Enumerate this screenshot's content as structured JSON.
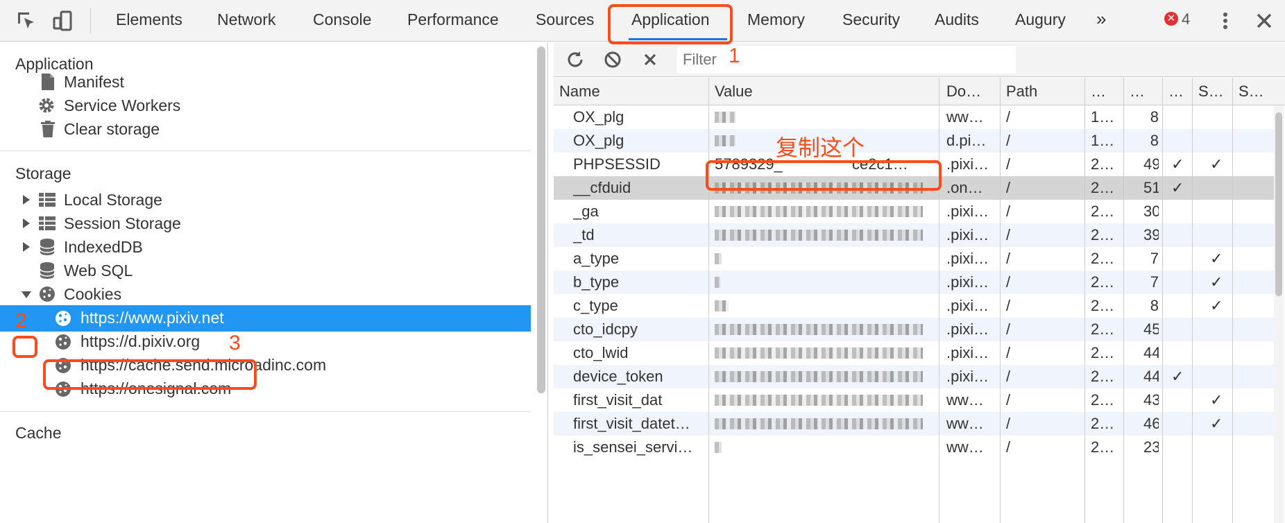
{
  "tabs": [
    "Elements",
    "Network",
    "Console",
    "Performance",
    "Sources",
    "Application",
    "Memory",
    "Security",
    "Audits",
    "Augury"
  ],
  "more_tabs": "»",
  "error_count": "4",
  "error_glyph": "✕",
  "sidebar": {
    "application_title": "Application",
    "application_items": [
      "Manifest",
      "Service Workers",
      "Clear storage"
    ],
    "storage_title": "Storage",
    "storage_items": [
      "Local Storage",
      "Session Storage",
      "IndexedDB",
      "Web SQL",
      "Cookies"
    ],
    "cookie_sites": [
      "https://www.pixiv.net",
      "https://d.pixiv.org",
      "https://cache.send.microadinc.com",
      "https://onesignal.com"
    ],
    "cache_title": "Cache"
  },
  "toolbar": {
    "filter_placeholder": "Filter"
  },
  "annotations": {
    "n1": "1",
    "n2": "2",
    "n3": "3",
    "copy_note": "复制这个"
  },
  "table": {
    "headers": [
      "Name",
      "Value",
      "Do…",
      "Path",
      "…",
      "…",
      "…",
      "S…",
      "S…"
    ],
    "rows": [
      {
        "name": "OX_plg",
        "value": "",
        "domain": "ww…",
        "path": "/",
        "exp": "1…",
        "size": "8",
        "http": "",
        "secure": ""
      },
      {
        "name": "OX_plg",
        "value": "",
        "domain": "d.pi…",
        "path": "/",
        "exp": "1…",
        "size": "8",
        "http": "",
        "secure": ""
      },
      {
        "name": "PHPSESSID",
        "value": "5789329_",
        "value_tail": "ce2c1…",
        "domain": ".pixi…",
        "path": "/",
        "exp": "2…",
        "size": "49",
        "http": "✓",
        "secure": "✓"
      },
      {
        "name": "__cfduid",
        "value": "",
        "domain": ".on…",
        "path": "/",
        "exp": "2…",
        "size": "51",
        "http": "✓",
        "secure": ""
      },
      {
        "name": "_ga",
        "value": "",
        "domain": ".pixi…",
        "path": "/",
        "exp": "2…",
        "size": "30",
        "http": "",
        "secure": ""
      },
      {
        "name": "_td",
        "value": "",
        "domain": ".pixi…",
        "path": "/",
        "exp": "2…",
        "size": "39",
        "http": "",
        "secure": ""
      },
      {
        "name": "a_type",
        "value": "",
        "domain": ".pixi…",
        "path": "/",
        "exp": "2…",
        "size": "7",
        "http": "",
        "secure": "✓"
      },
      {
        "name": "b_type",
        "value": "",
        "domain": ".pixi…",
        "path": "/",
        "exp": "2…",
        "size": "7",
        "http": "",
        "secure": "✓"
      },
      {
        "name": "c_type",
        "value": "",
        "domain": ".pixi…",
        "path": "/",
        "exp": "2…",
        "size": "8",
        "http": "",
        "secure": "✓"
      },
      {
        "name": "cto_idcpy",
        "value": "",
        "domain": ".pixi…",
        "path": "/",
        "exp": "2…",
        "size": "45",
        "http": "",
        "secure": ""
      },
      {
        "name": "cto_lwid",
        "value": "",
        "domain": ".pixi…",
        "path": "/",
        "exp": "2…",
        "size": "44",
        "http": "",
        "secure": ""
      },
      {
        "name": "device_token",
        "value": "",
        "domain": ".pixi…",
        "path": "/",
        "exp": "2…",
        "size": "44",
        "http": "✓",
        "secure": ""
      },
      {
        "name": "first_visit_dat",
        "value": "",
        "domain": "ww…",
        "path": "/",
        "exp": "2…",
        "size": "43",
        "http": "",
        "secure": "✓"
      },
      {
        "name": "first_visit_datet…",
        "value": "",
        "domain": "ww…",
        "path": "/",
        "exp": "2…",
        "size": "46",
        "http": "",
        "secure": "✓"
      },
      {
        "name": "is_sensei_servi…",
        "value": "",
        "domain": "ww…",
        "path": "/",
        "exp": "2…",
        "size": "23",
        "http": "",
        "secure": ""
      }
    ]
  },
  "colors": {
    "accent": "#1a73e8",
    "selected": "#2196f3",
    "annotation": "#ff4b1a",
    "error": "#e03232"
  }
}
